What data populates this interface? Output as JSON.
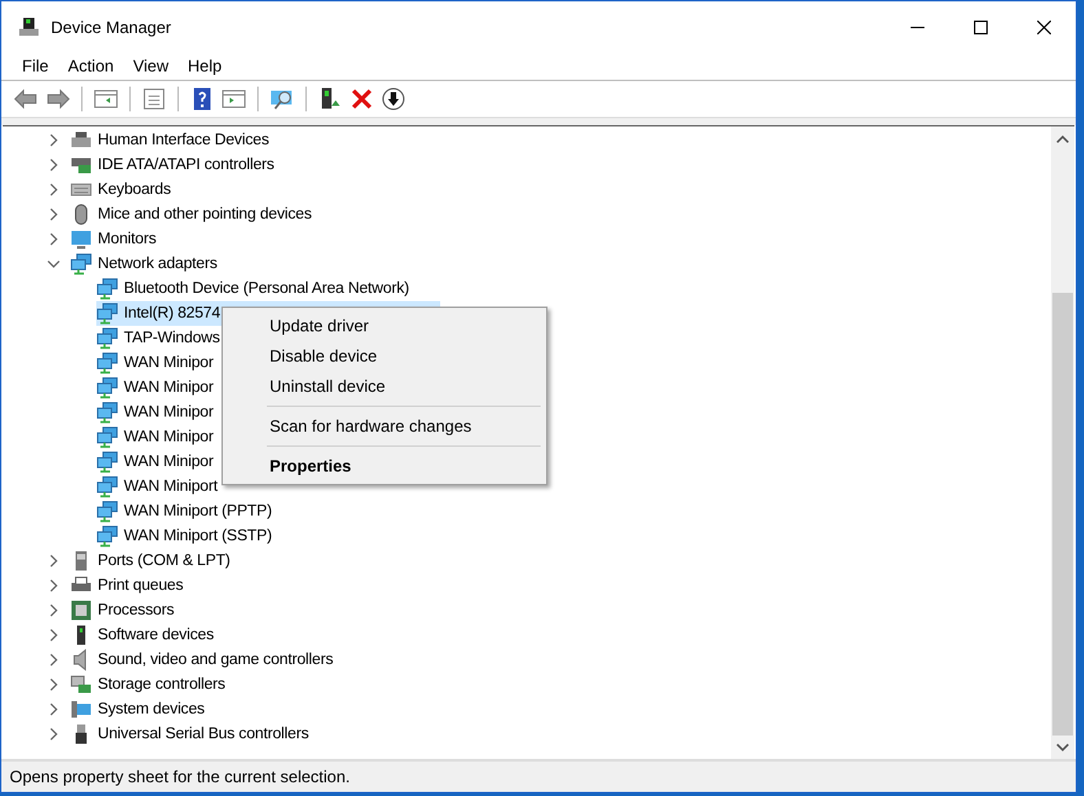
{
  "window": {
    "title": "Device Manager"
  },
  "menu": [
    "File",
    "Action",
    "View",
    "Help"
  ],
  "tree": [
    {
      "label": "Human Interface Devices",
      "expanded": false
    },
    {
      "label": "IDE ATA/ATAPI controllers",
      "expanded": false
    },
    {
      "label": "Keyboards",
      "expanded": false
    },
    {
      "label": "Mice and other pointing devices",
      "expanded": false
    },
    {
      "label": "Monitors",
      "expanded": false
    },
    {
      "label": "Network adapters",
      "expanded": true,
      "children": [
        {
          "label": "Bluetooth Device (Personal Area Network)",
          "selected": false
        },
        {
          "label": "Intel(R) 82574",
          "selected": true
        },
        {
          "label": "TAP-Windows",
          "selected": false
        },
        {
          "label": "WAN Minipor",
          "selected": false
        },
        {
          "label": "WAN Minipor",
          "selected": false
        },
        {
          "label": "WAN Minipor",
          "selected": false
        },
        {
          "label": "WAN Minipor",
          "selected": false
        },
        {
          "label": "WAN Minipor",
          "selected": false
        },
        {
          "label": "WAN Miniport",
          "selected": false
        },
        {
          "label": "WAN Miniport (PPTP)",
          "selected": false
        },
        {
          "label": "WAN Miniport (SSTP)",
          "selected": false
        }
      ]
    },
    {
      "label": "Ports (COM & LPT)",
      "expanded": false
    },
    {
      "label": "Print queues",
      "expanded": false
    },
    {
      "label": "Processors",
      "expanded": false
    },
    {
      "label": "Software devices",
      "expanded": false
    },
    {
      "label": "Sound, video and game controllers",
      "expanded": false
    },
    {
      "label": "Storage controllers",
      "expanded": false
    },
    {
      "label": "System devices",
      "expanded": false
    },
    {
      "label": "Universal Serial Bus controllers",
      "expanded": false
    }
  ],
  "context_menu": [
    {
      "label": "Update driver",
      "kind": "item"
    },
    {
      "label": "Disable device",
      "kind": "item"
    },
    {
      "label": "Uninstall device",
      "kind": "item"
    },
    {
      "kind": "separator"
    },
    {
      "label": "Scan for hardware changes",
      "kind": "item"
    },
    {
      "kind": "separator"
    },
    {
      "label": "Properties",
      "kind": "default"
    }
  ],
  "status_bar": "Opens property sheet for the current selection."
}
